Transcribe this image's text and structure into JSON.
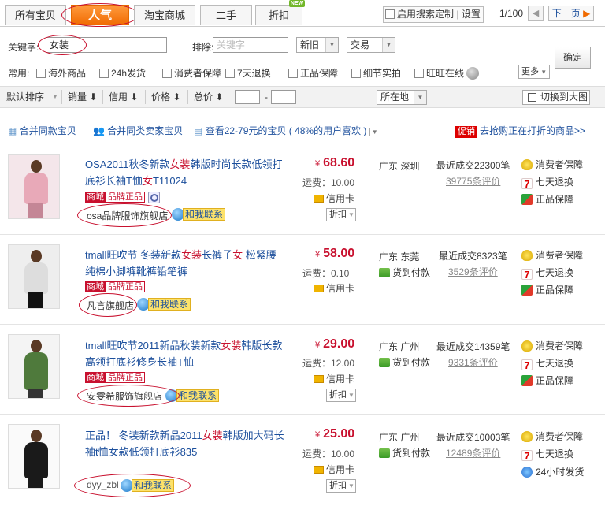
{
  "tabs": [
    {
      "label": "所有宝贝"
    },
    {
      "label": "人气"
    },
    {
      "label": "淘宝商城"
    },
    {
      "label": "二手"
    },
    {
      "label": "折扣"
    }
  ],
  "new_badge": "NEW",
  "custom_search": {
    "label": "启用搜索定制",
    "setting": "设置"
  },
  "pager": {
    "text": "1/100",
    "prev": "◀",
    "next": "下一页"
  },
  "filter": {
    "keyword_label": "关键字:",
    "keyword_value": "女装",
    "exclude_label": "排除:",
    "exclude_placeholder": "关键字",
    "sel_condition": "新旧",
    "sel_trade": "交易",
    "confirm": "确定",
    "common_label": "常用:",
    "options": [
      "海外商品",
      "24h发货",
      "消费者保障",
      "7天退换",
      "正品保障",
      "细节实拍",
      "旺旺在线"
    ],
    "more": "更多"
  },
  "sortbar": {
    "default": "默认排序",
    "sales": "销量",
    "credit": "信用",
    "price": "价格",
    "total": "总价",
    "dash": "-",
    "location": "所在地",
    "big_image": "切换到大图"
  },
  "mergebar": {
    "merge_items": "合并同款宝贝",
    "merge_sellers": "合并同类卖家宝贝",
    "range_text": "查看22-79元的宝贝",
    "range_pct": "( 48%的用户喜欢 )",
    "promo_tag": "促销",
    "promo_text": "去抢购正在打折的商品>>"
  },
  "products": [
    {
      "title_a": "OSA2011秋冬新款",
      "title_hl": "女装",
      "title_b": "韩版时尚长款低领打底衫长袖T恤",
      "title_hl2": "女",
      "title_c": "T11024",
      "mall_a": "商城",
      "mall_b": "品牌正品",
      "shop": "osa品牌服饰旗舰店",
      "contact": "和我联系",
      "price": "68.60",
      "yen": "¥",
      "shipping": "运费：10.00",
      "payment": "信用卡",
      "discount": "折扣",
      "location": "广东 深圳",
      "recent": "最近成交22300笔",
      "reviews": "39775条评价",
      "services": [
        "消费者保障",
        "七天退换",
        "正品保障"
      ]
    },
    {
      "title_a": "tmall旺吹节 冬装新款",
      "title_hl": "女装",
      "title_b": "长裤子",
      "title_hl2": "女",
      "title_c": " 松紧腰纯棉小脚裤靴裤铅笔裤",
      "mall_a": "商城",
      "mall_b": "品牌正品",
      "shop": "凡言旗舰店",
      "contact": "和我联系",
      "price": "58.00",
      "yen": "¥",
      "shipping": "运费：0.10",
      "payment": "信用卡",
      "payment2": "货到付款",
      "location": "广东 东莞",
      "recent": "最近成交8323笔",
      "reviews": "3529条评价",
      "services": [
        "消费者保障",
        "七天退换",
        "正品保障"
      ]
    },
    {
      "title_a": "tmall旺吹节2011新品秋装新款",
      "title_hl": "女装",
      "title_b": "韩版长款高领打底衫修身长袖T恤",
      "mall_a": "商城",
      "mall_b": "品牌正品",
      "shop": "安雯希服饰旗舰店",
      "contact": "和我联系",
      "price": "29.00",
      "yen": "¥",
      "shipping": "运费：12.00",
      "payment": "信用卡",
      "payment2": "货到付款",
      "discount": "折扣",
      "location": "广东 广州",
      "recent": "最近成交14359笔",
      "reviews": "9331条评价",
      "services": [
        "消费者保障",
        "七天退换",
        "正品保障"
      ]
    },
    {
      "title_a": "正品！ 冬装新款新品2011",
      "title_hl": "女装",
      "title_b": "韩版加大码长袖t恤女款低领打底衫835",
      "shop": "dyy_zbl",
      "contact": "和我联系",
      "price": "25.00",
      "yen": "¥",
      "shipping": "运费：10.00",
      "payment": "信用卡",
      "payment2": "货到付款",
      "discount": "折扣",
      "location": "广东 广州",
      "recent": "最近成交10003笔",
      "reviews": "12489条评价",
      "services": [
        "消费者保障",
        "七天退换",
        "24小时发货"
      ]
    }
  ]
}
